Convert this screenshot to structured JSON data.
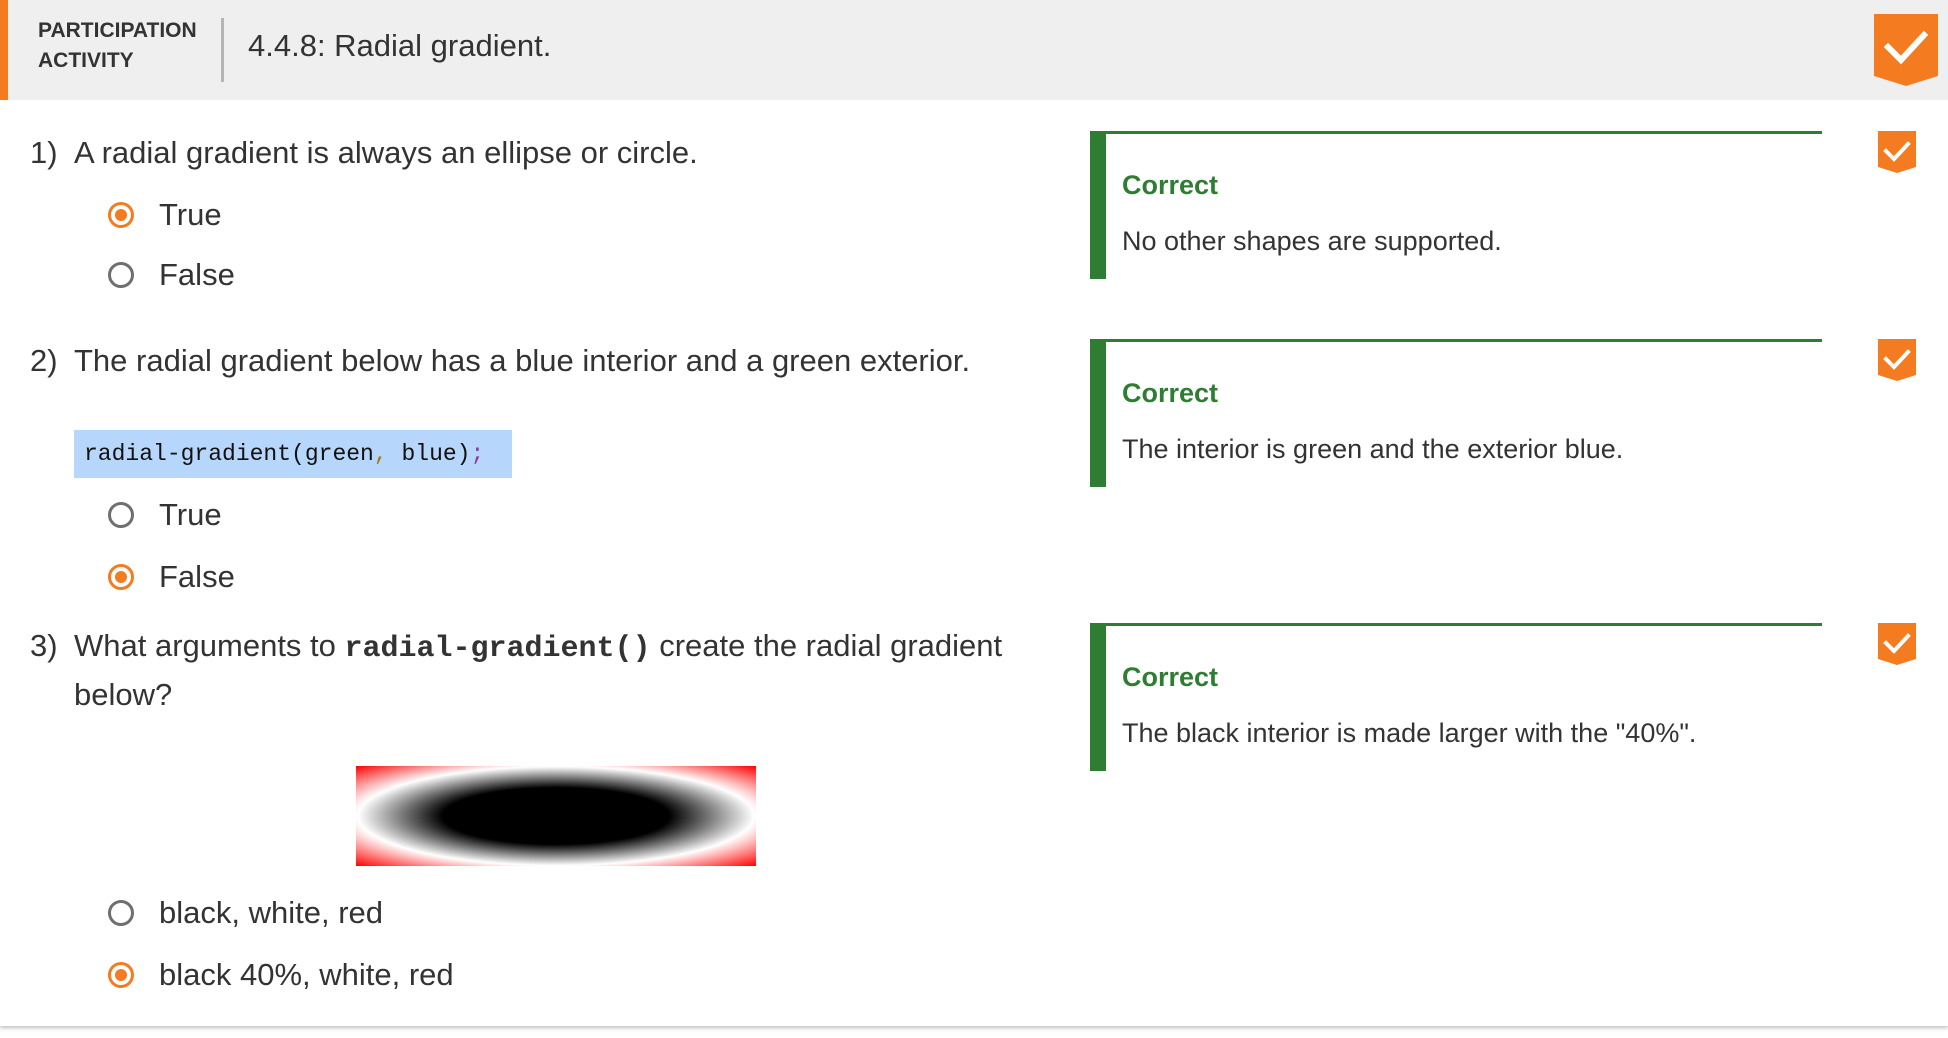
{
  "header": {
    "label_line1": "PARTICIPATION",
    "label_line2": "ACTIVITY",
    "title": "4.4.8: Radial gradient."
  },
  "questions": [
    {
      "number": "1)",
      "text": "A radial gradient is always an ellipse or circle.",
      "options": [
        {
          "label": "True",
          "selected": true
        },
        {
          "label": "False",
          "selected": false
        }
      ],
      "feedback": {
        "title": "Correct",
        "text": "No other shapes are supported."
      }
    },
    {
      "number": "2)",
      "text": "The radial gradient below has a blue interior and a green exterior.",
      "code": {
        "fn": "radial-gradient(green",
        "comma": ",",
        "rest": " blue)",
        "semi": ";"
      },
      "options": [
        {
          "label": "True",
          "selected": false
        },
        {
          "label": "False",
          "selected": true
        }
      ],
      "feedback": {
        "title": "Correct",
        "text": "The interior is green and the exterior blue."
      }
    },
    {
      "number": "3)",
      "text_before": "What arguments to ",
      "text_code": "radial-gradient()",
      "text_after": " create the radial gradient below?",
      "options": [
        {
          "label": "black, white, red",
          "selected": false
        },
        {
          "label": "black 40%, white, red",
          "selected": true
        }
      ],
      "feedback": {
        "title": "Correct",
        "text": "The black interior is made larger with the \"40%\"."
      }
    }
  ],
  "colors": {
    "accent": "#f47b20",
    "correct_green": "#2e7d32",
    "code_bg": "#b7d6fc",
    "header_bg": "#efefef"
  }
}
